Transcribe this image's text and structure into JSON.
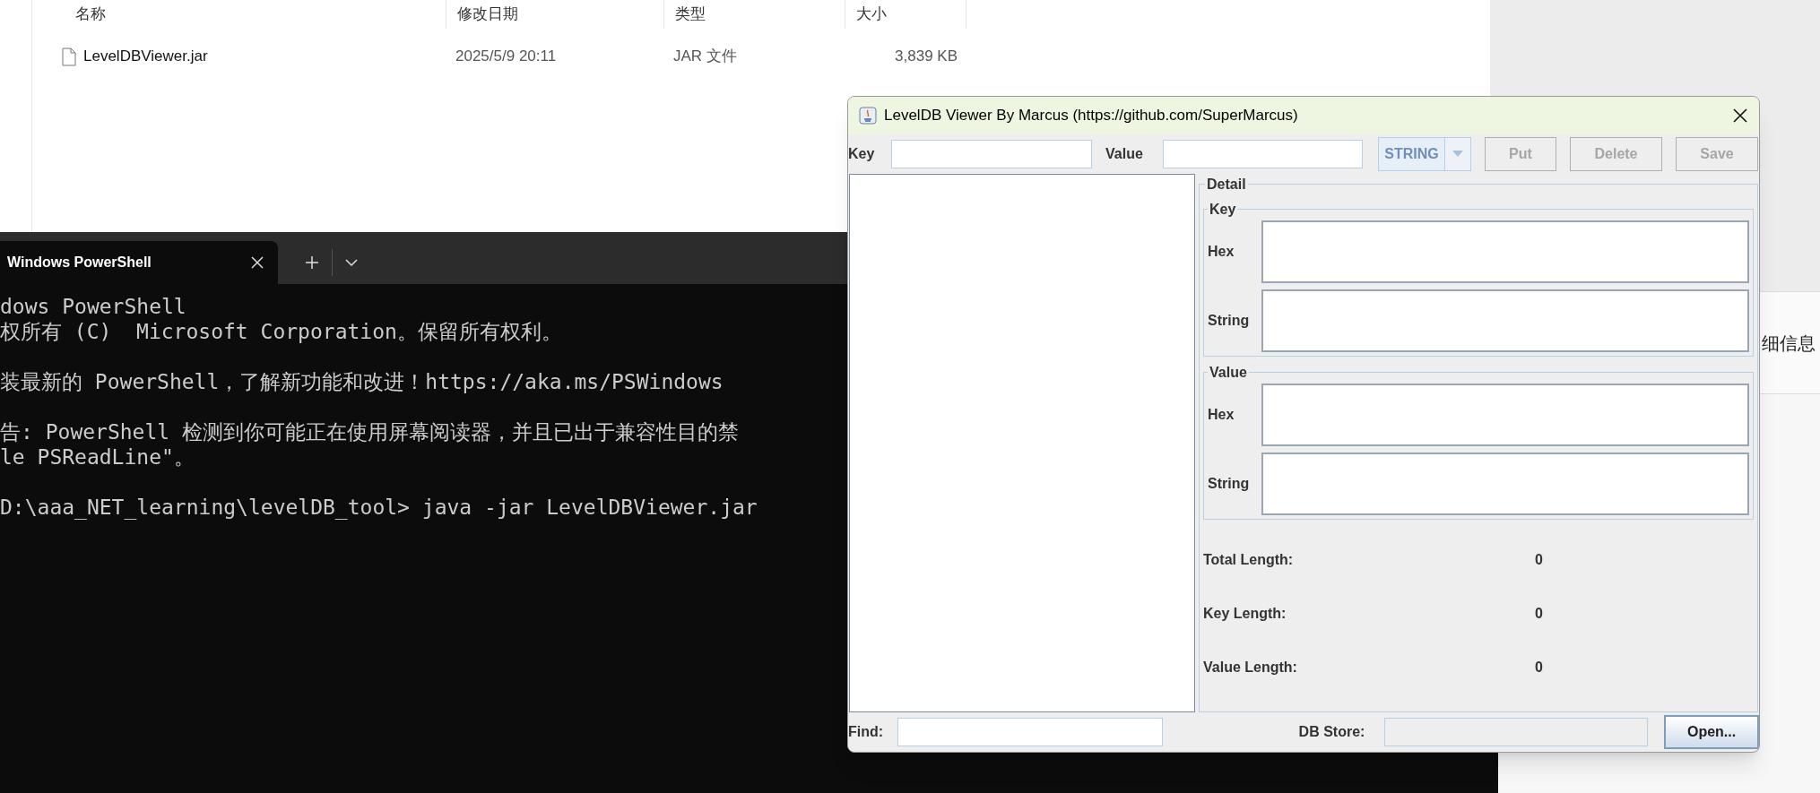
{
  "explorer": {
    "columns": [
      {
        "label": "名称"
      },
      {
        "label": "修改日期"
      },
      {
        "label": "类型"
      },
      {
        "label": "大小"
      }
    ],
    "files": [
      {
        "name": "LevelDBViewer.jar",
        "date": "2025/5/9 20:11",
        "type": "JAR 文件",
        "size": "3,839 KB"
      }
    ],
    "side_text": "细信息"
  },
  "terminal": {
    "tab_title": "Windows PowerShell",
    "paragraphs": [
      [
        "dows PowerShell",
        "权所有 (C)  Microsoft Corporation。保留所有权利。"
      ],
      [
        "装最新的 PowerShell，了解新功能和改进！https://aka.ms/PSWindows"
      ],
      [
        "告: PowerShell 检测到你可能正在使用屏幕阅读器，并且已出于兼容性目的禁",
        "le PSReadLine\"。"
      ],
      [
        "D:\\aaa_NET_learning\\levelDB_tool> java -jar LevelDBViewer.jar"
      ]
    ]
  },
  "app": {
    "title": "LevelDB Viewer By Marcus (https://github.com/SuperMarcus)",
    "key_label": "Key",
    "value_label": "Value",
    "type_combo": {
      "value": "STRING",
      "disabled": true
    },
    "buttons": [
      {
        "label": "Put",
        "disabled": true
      },
      {
        "label": "Delete",
        "disabled": true
      },
      {
        "label": "Save",
        "disabled": true
      }
    ],
    "detail": {
      "title": "Detail",
      "groups": [
        {
          "title": "Key",
          "fields": [
            {
              "label": "Hex"
            },
            {
              "label": "String"
            }
          ]
        },
        {
          "title": "Value",
          "fields": [
            {
              "label": "Hex"
            },
            {
              "label": "String"
            }
          ]
        }
      ],
      "stats": [
        {
          "label": "Total Length:",
          "value": "0"
        },
        {
          "label": "Key Length:",
          "value": "0"
        },
        {
          "label": "Value Length:",
          "value": "0"
        }
      ]
    },
    "find_label": "Find:",
    "db_store_label": "DB Store:",
    "open_button": "Open..."
  }
}
